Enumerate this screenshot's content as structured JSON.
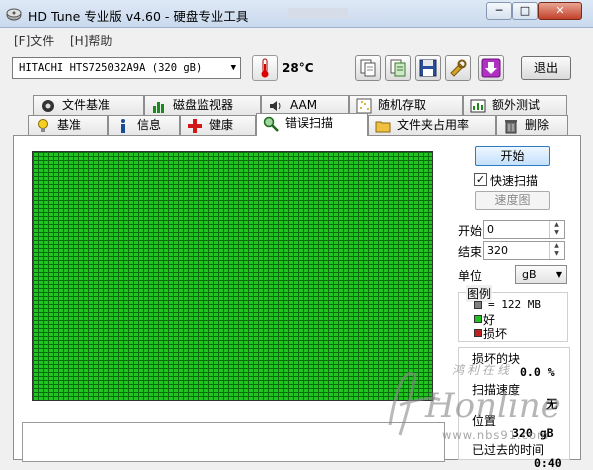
{
  "window": {
    "title": "HD Tune 专业版 v4.60 - 硬盘专业工具",
    "minimize": "─",
    "maximize": "□",
    "close": "✕"
  },
  "menu": {
    "file_key": "[F]",
    "file_label": "文件",
    "help_key": "[H]",
    "help_label": "帮助"
  },
  "toolbar": {
    "drive": "HITACHI HTS725032A9A   (320 gB)",
    "temperature": "28°C",
    "exit_label": "退出"
  },
  "tabs": {
    "row1": [
      "文件基准",
      "磁盘监视器",
      "AAM",
      "随机存取",
      "额外测试"
    ],
    "row2": [
      "基准",
      "信息",
      "健康",
      "错误扫描",
      "文件夹占用率",
      "删除"
    ],
    "active": "错误扫描"
  },
  "controls": {
    "start_label": "开始",
    "quick_scan_label": "快速扫描",
    "quick_scan_checked": true,
    "speed_map_label": "速度图",
    "start_field_label": "开始",
    "start_value": "0",
    "end_field_label": "结束",
    "end_value": "320",
    "unit_label": "单位",
    "unit_value": "gB"
  },
  "legend": {
    "title": "图例",
    "block_size": "= 122 MB",
    "good_label": "好",
    "bad_label": "损坏",
    "colors": {
      "block": "#808080",
      "good": "#22c022",
      "bad": "#c02020"
    }
  },
  "stats": {
    "damaged_label": "损坏的块",
    "damaged_value": "0.0 %",
    "scan_speed_label": "扫描速度",
    "scan_speed_value": "无",
    "position_label": "位置",
    "position_value": "320 gB",
    "elapsed_label": "已过去的时间",
    "elapsed_value": "0:40"
  },
  "watermark": {
    "script_text": "Honline",
    "cn_text": "鸿利在线",
    "url": "www.nbs91.com"
  }
}
